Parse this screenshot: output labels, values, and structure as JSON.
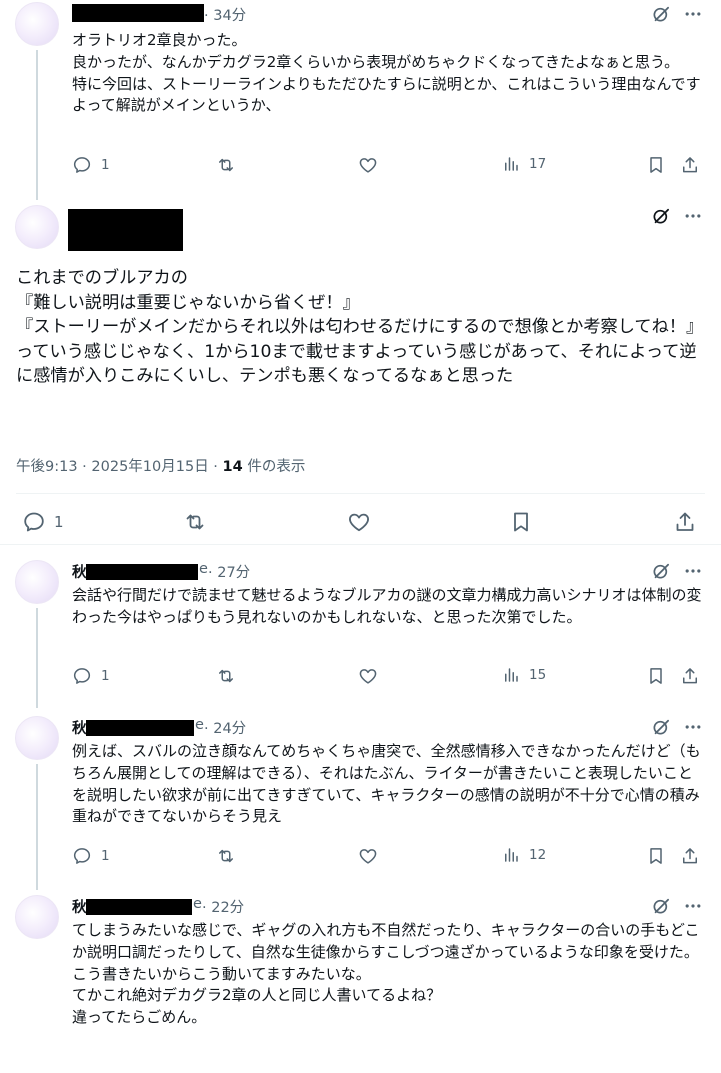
{
  "posts": [
    {
      "time": "· 34分",
      "text": "オラトリオ2章良かった。\n良かったが、なんかデカグラ2章くらいから表現がめちゃクドくなってきたよなぁと思う。\n特に今回は、ストーリーラインよりもただひたすらに説明とか、これはこういう理由なんですよって解説がメインというか、",
      "replies": "1",
      "views": "17"
    },
    {
      "time": "· 27分",
      "name_fragment": "秋",
      "handle_tail": "e",
      "text": "会話や行間だけで読ませて魅せるようなブルアカの謎の文章力構成力高いシナリオは体制の変わった今はやっぱりもう見れないのかもしれないな、と思った次第でした。",
      "replies": "1",
      "views": "15"
    },
    {
      "time": "· 24分",
      "name_fragment": "秋",
      "handle_tail": "e",
      "text": "例えば、スバルの泣き顔なんてめちゃくちゃ唐突で、全然感情移入できなかったんだけど（もちろん展開としての理解はできる）、それはたぶん、ライターが書きたいこと表現したいことを説明したい欲求が前に出てきすぎていて、キャラクターの感情の説明が不十分で心情の積み重ねができてないからそう見え",
      "replies": "1",
      "views": "12"
    },
    {
      "time": "· 22分",
      "name_fragment": "秋",
      "handle_tail": "e",
      "text": "てしまうみたいな感じで、ギャグの入れ方も不自然だったり、キャラクターの合いの手もどこか説明口調だったりして、自然な生徒像からすこしづつ遠ざかっているような印象を受けた。\nこう書きたいからこう動いてますみたいな。\nてかこれ絶対デカグラ2章の人と同じ人書いてるよね？\n違ってたらごめん。"
    }
  ],
  "main_post": {
    "text": "これまでのブルアカの\n『難しい説明は重要じゃないから省くぜ！』\n『ストーリーがメインだからそれ以外は匂わせるだけにするので想像とか考察してね！』\nっていう感じじゃなく、1から10まで載せますよっていう感じがあって、それによって逆に感情が入りこみにくいし、テンポも悪くなってるなぁと思った",
    "timestamp": "午後9:13 · 2025年10月15日 · ",
    "views_count": "14",
    "views_suffix": " 件の表示",
    "replies": "1"
  },
  "icons": [
    "grok-icon",
    "more-icon",
    "reply-icon",
    "repost-icon",
    "like-icon",
    "views-icon",
    "bookmark-icon",
    "share-icon"
  ],
  "colors": {
    "text": "#0f1419",
    "muted": "#536471",
    "divider": "#eff3f4",
    "thread_line": "#cfd9de"
  }
}
